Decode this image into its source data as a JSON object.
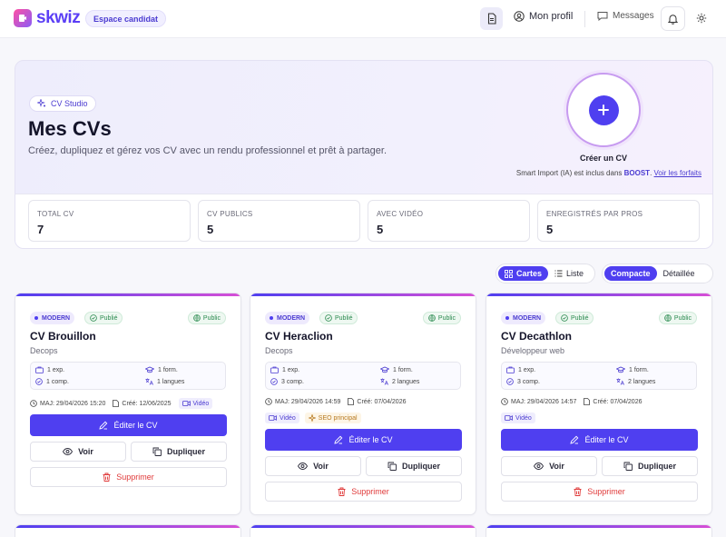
{
  "nav": {
    "brand": "skwiz",
    "space_badge": "Espace candidat",
    "profile": "Mon profil",
    "messages": "Messages"
  },
  "hero": {
    "chip": "CV Studio",
    "title": "Mes CVs",
    "subtitle": "Créez, dupliquez et gérez vos CV avec un rendu professionnel et prêt à partager.",
    "create_label": "Créer un CV",
    "smart_import_prefix": "Smart Import (IA) est inclus dans ",
    "smart_import_boost": "BOOST",
    "smart_import_mid": ". ",
    "smart_import_link": "Voir les forfaits"
  },
  "stats": [
    {
      "label": "TOTAL CV",
      "value": "7"
    },
    {
      "label": "CV PUBLICS",
      "value": "5"
    },
    {
      "label": "AVEC VIDÉO",
      "value": "5"
    },
    {
      "label": "ENREGISTRÉS PAR PROS",
      "value": "5"
    }
  ],
  "view_toggle": {
    "cards": "Cartes",
    "list": "Liste"
  },
  "density_toggle": {
    "compact": "Compacte",
    "detailed": "Détaillée"
  },
  "cards": [
    {
      "template": "MODERN",
      "status": "Publié",
      "visibility": "Public",
      "title": "CV Brouillon",
      "subtitle": "Decops",
      "exp": "1 exp.",
      "form": "1 form.",
      "comp": "1 comp.",
      "langues": "1 langues",
      "maj": "MAJ: 29/04/2026 15:20",
      "cree": "Créé: 12/06/2025",
      "tags": [
        "Vidéo"
      ],
      "edit": "Éditer le CV",
      "view": "Voir",
      "duplicate": "Dupliquer",
      "delete": "Supprimer"
    },
    {
      "template": "MODERN",
      "status": "Publié",
      "visibility": "Public",
      "title": "CV Heraclion",
      "subtitle": "Decops",
      "exp": "1 exp.",
      "form": "1 form.",
      "comp": "3 comp.",
      "langues": "2 langues",
      "maj": "MAJ: 29/04/2026 14:59",
      "cree": "Créé: 07/04/2026",
      "tags": [
        "Vidéo",
        "SEO principal"
      ],
      "edit": "Éditer le CV",
      "view": "Voir",
      "duplicate": "Dupliquer",
      "delete": "Supprimer"
    },
    {
      "template": "MODERN",
      "status": "Publié",
      "visibility": "Public",
      "title": "CV Decathlon",
      "subtitle": "Développeur web",
      "exp": "1 exp.",
      "form": "1 form.",
      "comp": "3 comp.",
      "langues": "2 langues",
      "maj": "MAJ: 29/04/2026 14:57",
      "cree": "Créé: 07/04/2026",
      "tags": [
        "Vidéo"
      ],
      "edit": "Éditer le CV",
      "view": "Voir",
      "duplicate": "Dupliquer",
      "delete": "Supprimer"
    }
  ],
  "colors": {
    "accent": "#4f3ff0",
    "success": "#2a8a4f",
    "danger": "#e03a3a",
    "seo": "#b7791f"
  }
}
